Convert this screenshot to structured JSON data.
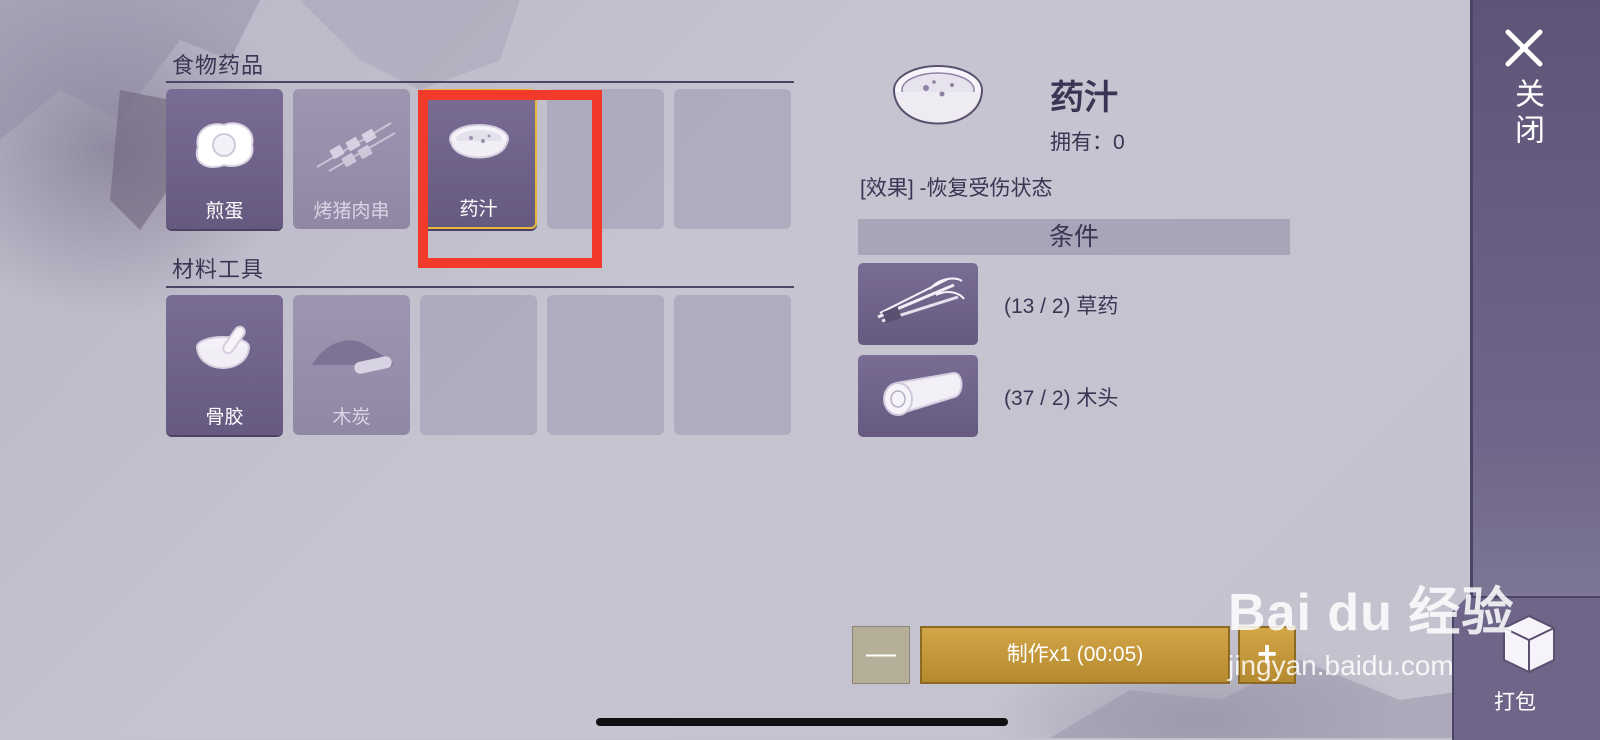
{
  "categories": [
    {
      "title": "食物药品",
      "slots": [
        {
          "label": "煎蛋",
          "icon": "fried-egg-icon",
          "state": "filled"
        },
        {
          "label": "烤猪肉串",
          "icon": "skewer-icon",
          "state": "dim"
        },
        {
          "label": "药汁",
          "icon": "potion-bowl-icon",
          "state": "selected"
        },
        {
          "label": "",
          "icon": "",
          "state": "empty"
        },
        {
          "label": "",
          "icon": "",
          "state": "empty"
        }
      ]
    },
    {
      "title": "材料工具",
      "slots": [
        {
          "label": "骨胶",
          "icon": "mortar-bowl-icon",
          "state": "filled"
        },
        {
          "label": "木炭",
          "icon": "charcoal-icon",
          "state": "dim"
        },
        {
          "label": "",
          "icon": "",
          "state": "empty"
        },
        {
          "label": "",
          "icon": "",
          "state": "empty"
        },
        {
          "label": "",
          "icon": "",
          "state": "empty"
        }
      ]
    }
  ],
  "detail": {
    "name": "药汁",
    "owned": "拥有：0",
    "effect": "[效果] -恢复受伤状态",
    "conditions_title": "条件",
    "requirements": [
      {
        "text": "(13 / 2) 草药",
        "icon": "herb-icon"
      },
      {
        "text": "(37 / 2) 木头",
        "icon": "wood-log-icon"
      }
    ]
  },
  "actions": {
    "minus": "—",
    "make": "制作x1 (00:05)",
    "plus": "+"
  },
  "side": {
    "close": "关闭",
    "pack": "打包"
  },
  "watermark": {
    "main": "Bai du 经验",
    "sub": "jingyan.baidu.com"
  },
  "colors": {
    "accent": "#d2a547",
    "highlight": "#f23a2a",
    "panel": "#5e5478",
    "text": "#3b3554"
  }
}
